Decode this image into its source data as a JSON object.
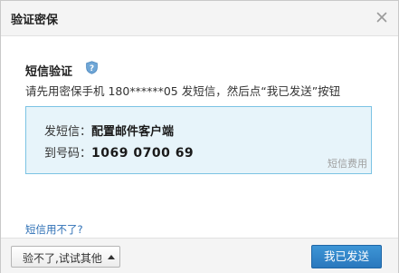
{
  "dialog": {
    "title": "验证密保",
    "close_icon": "close-icon"
  },
  "verification": {
    "section_title": "短信验证",
    "help_icon": "question-shield-icon",
    "instruction": "请先用密保手机 180******05 发短信，然后点“我已发送”按钮"
  },
  "sms": {
    "content_label": "发短信：",
    "content_value": "配置邮件客户端",
    "number_label": "到号码：",
    "number_value": "1069 0700 69",
    "fee_note": "短信费用"
  },
  "links": {
    "cannot_receive": "短信用不了?"
  },
  "footer": {
    "other_methods_label": "验不了,试试其他",
    "caret_icon": "caret-up-icon",
    "sent_button": "我已发送"
  },
  "colors": {
    "accent_blue": "#2a78bd",
    "box_bg": "#e7f4fa",
    "box_border": "#7cc3e4",
    "link": "#2d6fb5"
  }
}
